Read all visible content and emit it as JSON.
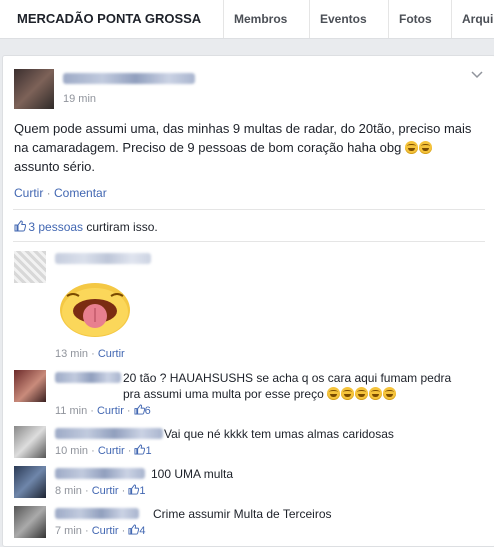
{
  "header": {
    "group_name": "MERCADÃO PONTA GROSSA",
    "tabs": [
      {
        "label": "Membros"
      },
      {
        "label": "Eventos"
      },
      {
        "label": "Fotos"
      },
      {
        "label": "Arqui"
      }
    ]
  },
  "post": {
    "time": "19 min",
    "text": "Quem pode assumi uma, das minhas 9 multas de radar, do 20tão, preciso mais na camaradagem. Preciso de 9 pessoas de bom coração haha obg",
    "text_suffix": "assunto sério.",
    "actions": {
      "like": "Curtir",
      "sep": " · ",
      "comment": "Comentar"
    },
    "likes": {
      "link": "3 pessoas",
      "rest": " curtiram isso."
    }
  },
  "comments": [
    {
      "text": "",
      "time": "13 min",
      "sep": " · ",
      "like": "Curtir",
      "likes_count": "",
      "has_sticker": true
    },
    {
      "text": "20 tão ? HAUAHSUSHS se acha q os cara aqui fumam pedra pra assumi uma multa por esse preço",
      "time": "11 min",
      "sep": " · ",
      "like": "Curtir",
      "likes_count": "6"
    },
    {
      "text": "Vai que né kkkk tem umas almas caridosas",
      "time": "10 min",
      "sep": " · ",
      "like": "Curtir",
      "likes_count": "1"
    },
    {
      "text": "100 UMA multa",
      "time": "8 min",
      "sep": " · ",
      "like": "Curtir",
      "likes_count": "1"
    },
    {
      "text": "Crime assumir Multa de Terceiros",
      "time": "7 min",
      "sep": " · ",
      "like": "Curtir",
      "likes_count": "4"
    }
  ],
  "colors": {
    "link": "#4267b2",
    "meta": "#90949c",
    "text": "#1d2129"
  }
}
